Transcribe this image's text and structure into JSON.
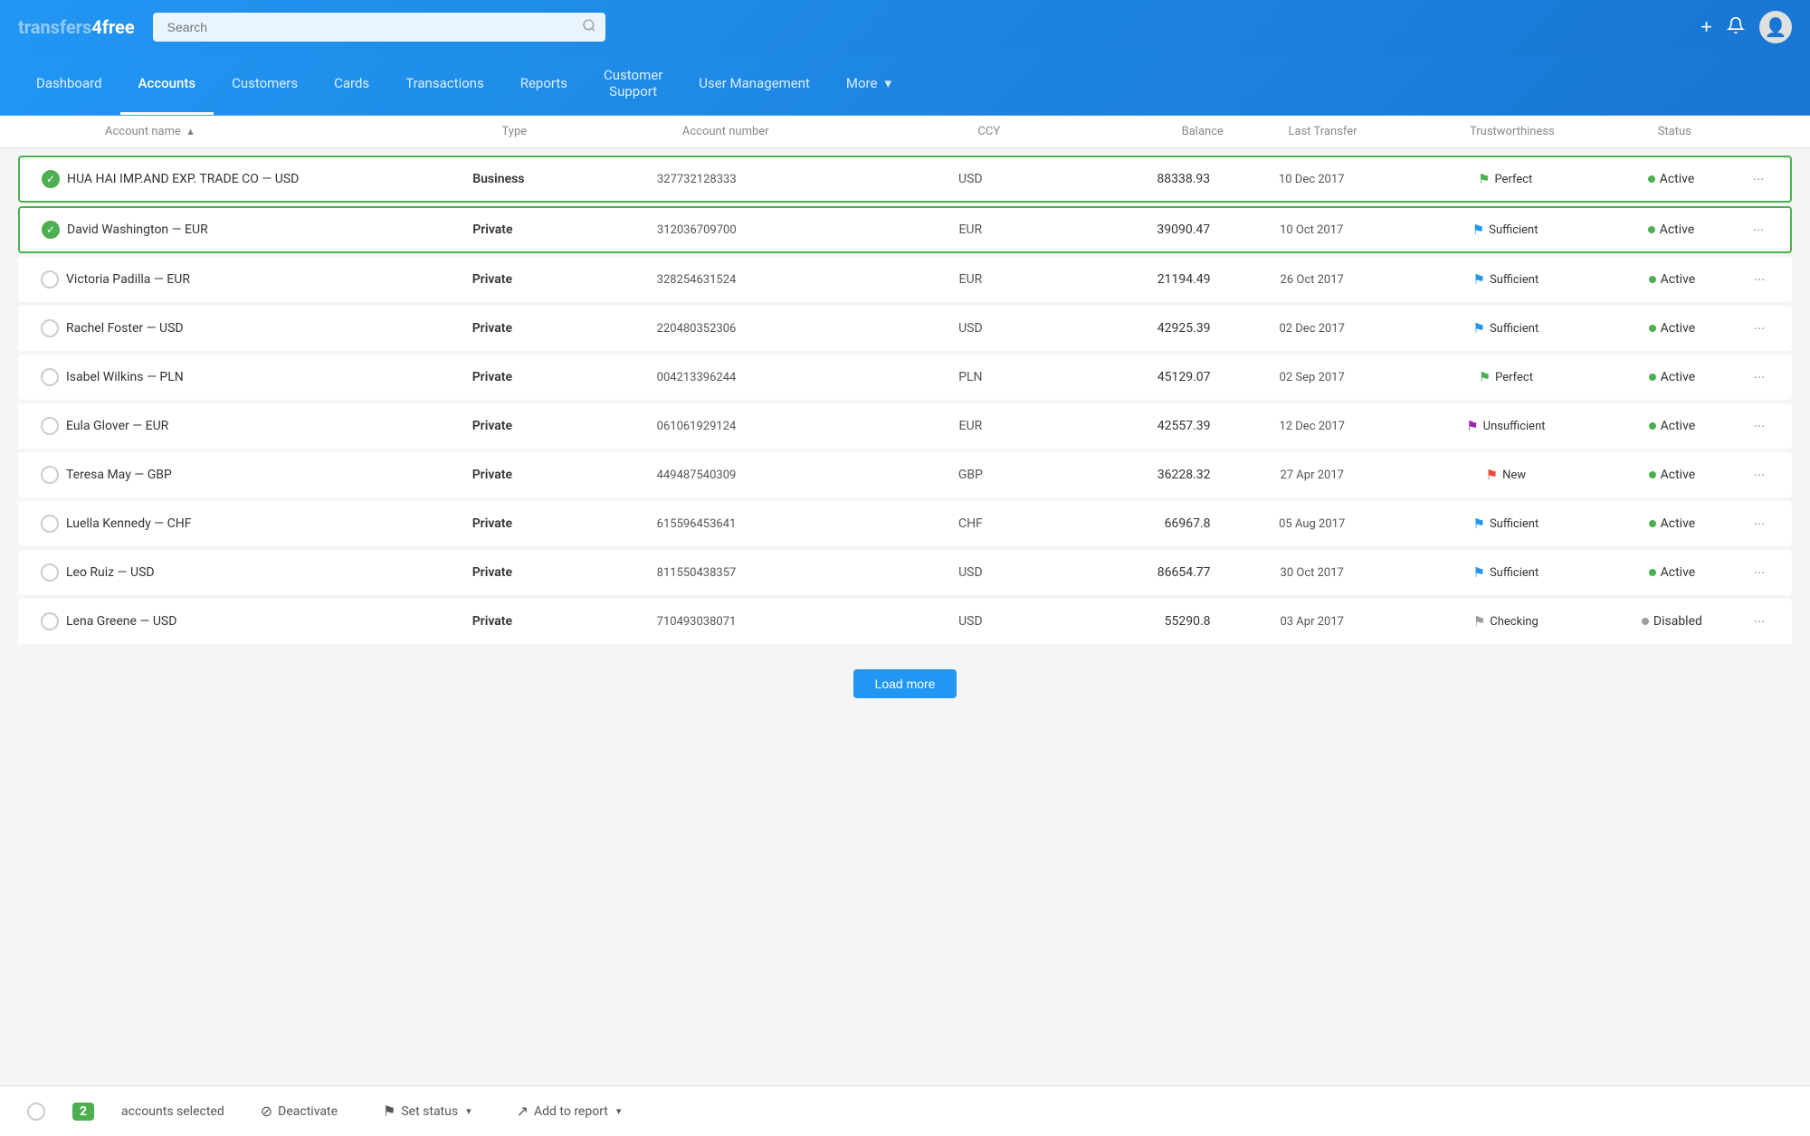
{
  "app": {
    "logo_text": "transfers4free",
    "search_placeholder": "Search"
  },
  "nav": {
    "items": [
      {
        "id": "dashboard",
        "label": "Dashboard",
        "active": false
      },
      {
        "id": "accounts",
        "label": "Accounts",
        "active": true
      },
      {
        "id": "customers",
        "label": "Customers",
        "active": false
      },
      {
        "id": "cards",
        "label": "Cards",
        "active": false
      },
      {
        "id": "transactions",
        "label": "Transactions",
        "active": false
      },
      {
        "id": "reports",
        "label": "Reports",
        "active": false
      },
      {
        "id": "customer-support",
        "label": "Customer Support",
        "active": false
      },
      {
        "id": "user-management",
        "label": "User Management",
        "active": false
      },
      {
        "id": "more",
        "label": "More",
        "active": false
      }
    ]
  },
  "table": {
    "columns": [
      {
        "id": "name",
        "label": "Account name",
        "sortable": true,
        "sort_dir": "asc"
      },
      {
        "id": "type",
        "label": "Type"
      },
      {
        "id": "account_number",
        "label": "Account number"
      },
      {
        "id": "ccy",
        "label": "CCY"
      },
      {
        "id": "balance",
        "label": "Balance"
      },
      {
        "id": "last_transfer",
        "label": "Last Transfer"
      },
      {
        "id": "trustworthiness",
        "label": "Trustworthiness"
      },
      {
        "id": "status",
        "label": "Status"
      }
    ],
    "rows": [
      {
        "id": 1,
        "selected": true,
        "name": "HUA HAI IMP.AND EXP. TRADE CO — USD",
        "type": "Business",
        "account_number": "327732128333",
        "ccy": "USD",
        "balance": "88338.93",
        "last_transfer": "10 Dec 2017",
        "trust_flag": "green",
        "trust_label": "Perfect",
        "status_dot": "green",
        "status_label": "Active"
      },
      {
        "id": 2,
        "selected": true,
        "name": "David Washington — EUR",
        "type": "Private",
        "account_number": "312036709700",
        "ccy": "EUR",
        "balance": "39090.47",
        "last_transfer": "10 Oct 2017",
        "trust_flag": "blue",
        "trust_label": "Sufficient",
        "status_dot": "green",
        "status_label": "Active"
      },
      {
        "id": 3,
        "selected": false,
        "name": "Victoria Padilla — EUR",
        "type": "Private",
        "account_number": "328254631524",
        "ccy": "EUR",
        "balance": "21194.49",
        "last_transfer": "26 Oct 2017",
        "trust_flag": "blue",
        "trust_label": "Sufficient",
        "status_dot": "green",
        "status_label": "Active"
      },
      {
        "id": 4,
        "selected": false,
        "name": "Rachel Foster — USD",
        "type": "Private",
        "account_number": "220480352306",
        "ccy": "USD",
        "balance": "42925.39",
        "last_transfer": "02 Dec 2017",
        "trust_flag": "blue",
        "trust_label": "Sufficient",
        "status_dot": "green",
        "status_label": "Active"
      },
      {
        "id": 5,
        "selected": false,
        "name": "Isabel Wilkins — PLN",
        "type": "Private",
        "account_number": "004213396244",
        "ccy": "PLN",
        "balance": "45129.07",
        "last_transfer": "02 Sep 2017",
        "trust_flag": "green",
        "trust_label": "Perfect",
        "status_dot": "green",
        "status_label": "Active"
      },
      {
        "id": 6,
        "selected": false,
        "name": "Eula Glover — EUR",
        "type": "Private",
        "account_number": "061061929124",
        "ccy": "EUR",
        "balance": "42557.39",
        "last_transfer": "12 Dec 2017",
        "trust_flag": "purple",
        "trust_label": "Unsufficient",
        "status_dot": "green",
        "status_label": "Active"
      },
      {
        "id": 7,
        "selected": false,
        "name": "Teresa May — GBP",
        "type": "Private",
        "account_number": "449487540309",
        "ccy": "GBP",
        "balance": "36228.32",
        "last_transfer": "27 Apr 2017",
        "trust_flag": "red",
        "trust_label": "New",
        "status_dot": "green",
        "status_label": "Active"
      },
      {
        "id": 8,
        "selected": false,
        "name": "Luella Kennedy — CHF",
        "type": "Private",
        "account_number": "615596453641",
        "ccy": "CHF",
        "balance": "66967.8",
        "last_transfer": "05 Aug 2017",
        "trust_flag": "blue",
        "trust_label": "Sufficient",
        "status_dot": "green",
        "status_label": "Active"
      },
      {
        "id": 9,
        "selected": false,
        "name": "Leo Ruiz — USD",
        "type": "Private",
        "account_number": "811550438357",
        "ccy": "USD",
        "balance": "86654.77",
        "last_transfer": "30 Oct 2017",
        "trust_flag": "blue",
        "trust_label": "Sufficient",
        "status_dot": "green",
        "status_label": "Active"
      },
      {
        "id": 10,
        "selected": false,
        "name": "Lena Greene — USD",
        "type": "Private",
        "account_number": "710493038071",
        "ccy": "USD",
        "balance": "55290.8",
        "last_transfer": "03 Apr 2017",
        "trust_flag": "gray",
        "trust_label": "Checking",
        "status_dot": "gray",
        "status_label": "Disabled"
      }
    ]
  },
  "bottom_bar": {
    "selected_count": "2",
    "accounts_selected_label": "accounts selected",
    "deactivate_label": "Deactivate",
    "set_status_label": "Set status",
    "add_to_report_label": "Add to report"
  }
}
